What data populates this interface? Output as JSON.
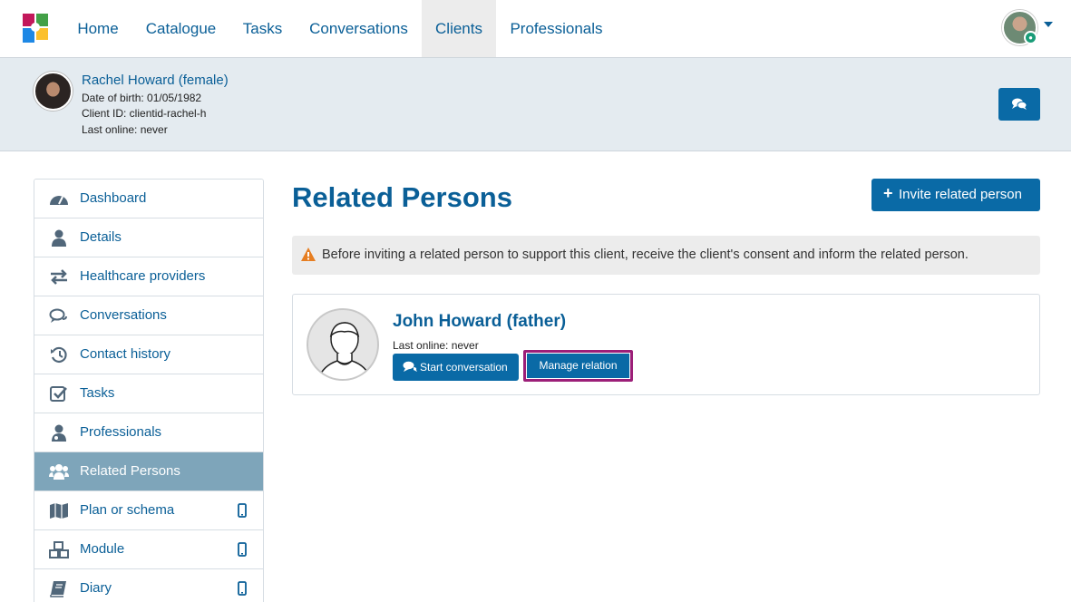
{
  "nav": {
    "items": [
      {
        "label": "Home"
      },
      {
        "label": "Catalogue"
      },
      {
        "label": "Tasks"
      },
      {
        "label": "Conversations"
      },
      {
        "label": "Clients",
        "active": true
      },
      {
        "label": "Professionals"
      }
    ],
    "logo_icon": "multicolor-puzzle-logo",
    "user_menu_icon": "chevron-down-icon"
  },
  "client": {
    "name": "Rachel Howard (female)",
    "dob": "Date of birth: 01/05/1982",
    "client_id": "Client ID: clientid-rachel-h",
    "last_online": "Last online: never",
    "chat_button_icon": "comments-icon"
  },
  "sidebar": {
    "items": [
      {
        "label": "Dashboard",
        "icon": "dashboard-icon"
      },
      {
        "label": "Details",
        "icon": "user-icon"
      },
      {
        "label": "Healthcare providers",
        "icon": "exchange-icon"
      },
      {
        "label": "Conversations",
        "icon": "comments-icon"
      },
      {
        "label": "Contact history",
        "icon": "history-icon"
      },
      {
        "label": "Tasks",
        "icon": "checkbox-icon"
      },
      {
        "label": "Professionals",
        "icon": "doctor-icon"
      },
      {
        "label": "Related Persons",
        "icon": "users-icon",
        "active": true
      },
      {
        "label": "Plan or schema",
        "icon": "map-icon",
        "mobile": true
      },
      {
        "label": "Module",
        "icon": "cubes-icon",
        "mobile": true
      },
      {
        "label": "Diary",
        "icon": "book-icon",
        "mobile": true
      }
    ]
  },
  "main": {
    "title": "Related Persons",
    "invite_label": "Invite related person",
    "alert_text": "Before inviting a related person to support this client, receive the client's consent and inform the related person.",
    "colors": {
      "primary": "#0a6aa6",
      "link": "#0a5f97",
      "active_sidebar": "#7ea5ba",
      "highlight": "#9c1f78",
      "warning": "#e67e22"
    }
  },
  "related_person": {
    "name": "John Howard (father)",
    "last_online": "Last online: never",
    "start_conversation_label": "Start conversation",
    "manage_relation_label": "Manage relation"
  }
}
